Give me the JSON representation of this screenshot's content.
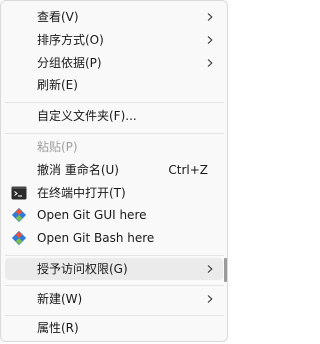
{
  "menu": {
    "items": {
      "view": {
        "label": "查看(V)"
      },
      "sort": {
        "label": "排序方式(O)"
      },
      "group": {
        "label": "分组依据(P)"
      },
      "refresh": {
        "label": "刷新(E)"
      },
      "customize": {
        "label": "自定义文件夹(F)..."
      },
      "paste": {
        "label": "粘贴(P)"
      },
      "undo": {
        "label": "撤消 重命名(U)",
        "shortcut": "Ctrl+Z"
      },
      "terminal": {
        "label": "在终端中打开(T)"
      },
      "git_gui": {
        "label": "Open Git GUI here"
      },
      "git_bash": {
        "label": "Open Git Bash here"
      },
      "access": {
        "label": "授予访问权限(G)"
      },
      "new": {
        "label": "新建(W)"
      },
      "properties": {
        "label": "属性(R)"
      }
    }
  },
  "colors": {
    "menu_bg": "#f9f9f9",
    "hover_bg": "#ebebeb",
    "disabled_text": "#a0a0a0",
    "git_orange": "#f05133",
    "git_blue": "#2f7bd8"
  }
}
